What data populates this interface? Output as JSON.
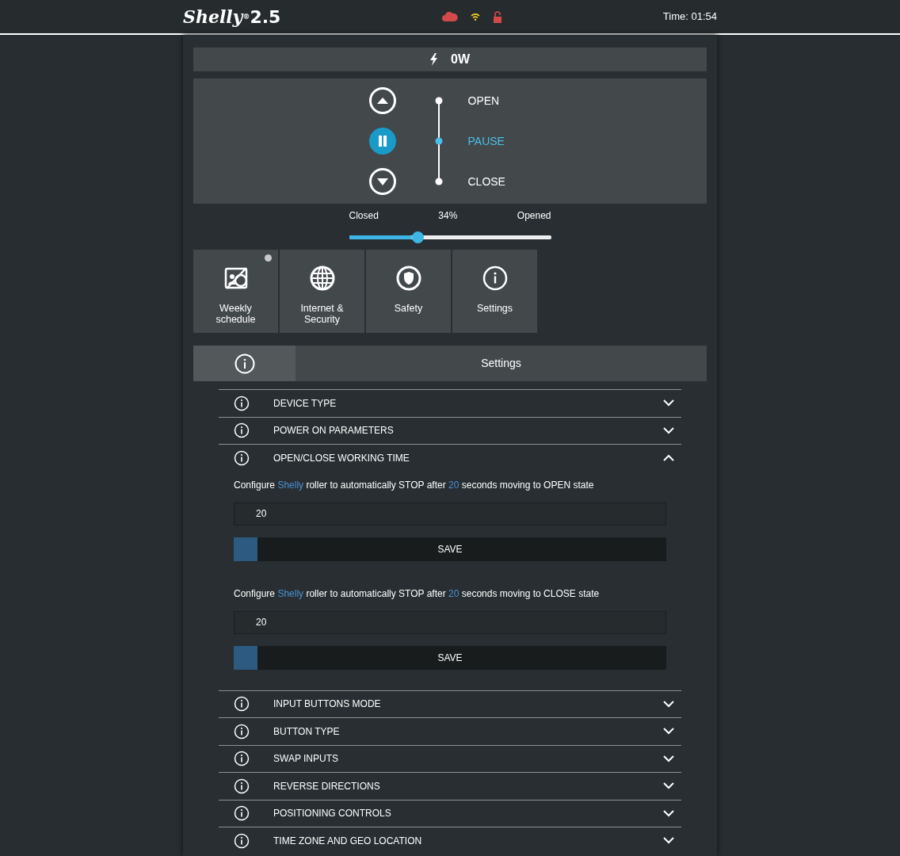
{
  "header": {
    "brand": "Shelly",
    "registered": "®",
    "model": "2.5",
    "time": "Time: 01:54"
  },
  "power": {
    "reading": "0W"
  },
  "roller": {
    "states": [
      {
        "label": "OPEN",
        "kind": "up",
        "selected": false
      },
      {
        "label": "PAUSE",
        "kind": "pause",
        "selected": true
      },
      {
        "label": "CLOSE",
        "kind": "down",
        "selected": false
      }
    ]
  },
  "position": {
    "min_label": "Closed",
    "reading": "34%",
    "max_label": "Opened",
    "level": 0.34
  },
  "tiles": [
    {
      "label": "Weekly schedule",
      "kind": "schedule",
      "notification": true
    },
    {
      "label": "Internet & Security",
      "kind": "globe",
      "notification": false
    },
    {
      "label": "Safety",
      "kind": "shield",
      "notification": false
    },
    {
      "label": "Settings",
      "kind": "info",
      "notification": false
    }
  ],
  "settings_tab": {
    "title": "Settings"
  },
  "sections": [
    {
      "title": "DEVICE TYPE",
      "expanded": false
    },
    {
      "title": "POWER ON PARAMETERS",
      "expanded": false
    },
    {
      "title": "OPEN/CLOSE WORKING TIME",
      "expanded": true,
      "fields": [
        {
          "description": [
            {
              "text": "Configure ",
              "highlight": false
            },
            {
              "text": "Shelly",
              "highlight": true
            },
            {
              "text": " roller to automatically STOP after ",
              "highlight": false
            },
            {
              "text": "20",
              "highlight": true
            },
            {
              "text": " seconds moving to OPEN state",
              "highlight": false
            }
          ],
          "value": "20",
          "button": "SAVE"
        },
        {
          "description": [
            {
              "text": "Configure ",
              "highlight": false
            },
            {
              "text": "Shelly",
              "highlight": true
            },
            {
              "text": " roller to automatically STOP after ",
              "highlight": false
            },
            {
              "text": "20",
              "highlight": true
            },
            {
              "text": " seconds moving to CLOSE state",
              "highlight": false
            }
          ],
          "value": "20",
          "button": "SAVE"
        }
      ]
    },
    {
      "title": "INPUT BUTTONS MODE",
      "expanded": false
    },
    {
      "title": "BUTTON TYPE",
      "expanded": false
    },
    {
      "title": "SWAP INPUTS",
      "expanded": false
    },
    {
      "title": "REVERSE DIRECTIONS",
      "expanded": false
    },
    {
      "title": "POSITIONING CONTROLS",
      "expanded": false
    },
    {
      "title": "TIME ZONE AND GEO LOCATION",
      "expanded": false
    }
  ]
}
